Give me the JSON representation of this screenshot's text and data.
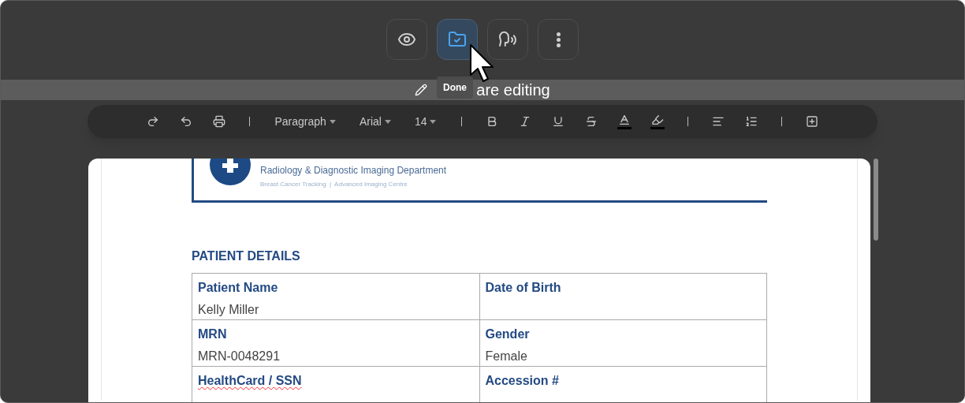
{
  "top_buttons": [
    {
      "selected": false
    },
    {
      "selected": true
    },
    {
      "selected": false
    },
    {
      "selected": false
    }
  ],
  "tooltip": "Done",
  "banner": "are editing",
  "format_toolbar": {
    "dropdowns": [
      {
        "label": "Paragraph"
      },
      {
        "label": "Arial"
      },
      {
        "label": "14"
      }
    ]
  },
  "document": {
    "header_subtitle": "Radiology & Diagnostic Imaging Department",
    "header_tagline": "Breast Cancer Tracking  |  Advanced Imaging Centre",
    "section_title": "PATIENT DETAILS",
    "rows": [
      [
        {
          "label": "Patient Name",
          "value": "Kelly Miller",
          "spellcheck_error": false
        },
        {
          "label": "Date of Birth",
          "spellcheck_error": false
        }
      ],
      [
        {
          "label": "MRN",
          "value": "MRN-0048291",
          "spellcheck_error": false
        },
        {
          "label": "Gender",
          "value": "Female",
          "spellcheck_error": false
        }
      ],
      [
        {
          "label": "HealthCard / SSN",
          "spellcheck_error": true
        },
        {
          "label": "Accession #",
          "spellcheck_error": false
        }
      ]
    ]
  }
}
